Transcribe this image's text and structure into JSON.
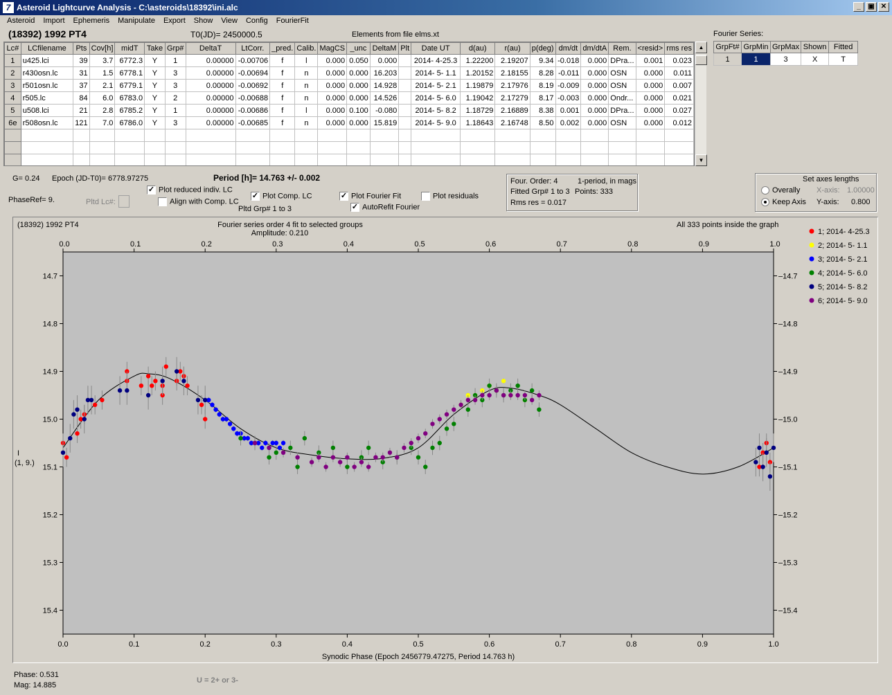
{
  "window": {
    "title": "Asteroid Lightcurve Analysis - C:\\asteroids\\18392\\ini.alc",
    "min": "_",
    "max": "▣",
    "close": "✕"
  },
  "menu": [
    "Asteroid",
    "Import",
    "Ephemeris",
    "Manipulate",
    "Export",
    "Show",
    "View",
    "Config",
    "FourierFit"
  ],
  "asteroid_name": "(18392) 1992 PT4",
  "t0": "T0(JD)= 2450000.5",
  "elements": "Elements from file elms.xt",
  "table": {
    "headers": [
      "Lc#",
      "LCfilename",
      "Pts",
      "Cov[h]",
      "midT",
      "Take",
      "Grp#",
      "DeltaT",
      "LtCorr.",
      "_pred.",
      "Calib.",
      "MagCS",
      "_unc",
      "DeltaM",
      "Plt",
      "Date UT",
      "d(au)",
      "r(au)",
      "p(deg)",
      "dm/dt",
      "dm/dtA",
      "Rem.",
      "<resid>",
      "rms res"
    ],
    "rows": [
      [
        "1",
        "u425.lci",
        "39",
        "3.7",
        "6772.3",
        "Y",
        "1",
        "0.00000",
        "-0.00706",
        "f",
        "l",
        "0.000",
        "0.050",
        "0.000",
        "",
        "2014- 4-25.3",
        "1.22200",
        "2.19207",
        "9.34",
        "-0.018",
        "0.000",
        "DPra...",
        "0.001",
        "0.023"
      ],
      [
        "2",
        "r430osn.lc",
        "31",
        "1.5",
        "6778.1",
        "Y",
        "3",
        "0.00000",
        "-0.00694",
        "f",
        "n",
        "0.000",
        "0.000",
        "16.203",
        "",
        "2014- 5- 1.1",
        "1.20152",
        "2.18155",
        "8.28",
        "-0.011",
        "0.000",
        "OSN",
        "0.000",
        "0.011"
      ],
      [
        "3",
        "r501osn.lc",
        "37",
        "2.1",
        "6779.1",
        "Y",
        "3",
        "0.00000",
        "-0.00692",
        "f",
        "n",
        "0.000",
        "0.000",
        "14.928",
        "",
        "2014- 5- 2.1",
        "1.19879",
        "2.17976",
        "8.19",
        "-0.009",
        "0.000",
        "OSN",
        "0.000",
        "0.007"
      ],
      [
        "4",
        "r505.lc",
        "84",
        "6.0",
        "6783.0",
        "Y",
        "2",
        "0.00000",
        "-0.00688",
        "f",
        "n",
        "0.000",
        "0.000",
        "14.526",
        "",
        "2014- 5- 6.0",
        "1.19042",
        "2.17279",
        "8.17",
        "-0.003",
        "0.000",
        "Ondr...",
        "0.000",
        "0.021"
      ],
      [
        "5",
        "u508.lci",
        "21",
        "2.8",
        "6785.2",
        "Y",
        "1",
        "0.00000",
        "-0.00686",
        "f",
        "l",
        "0.000",
        "0.100",
        "-0.080",
        "",
        "2014- 5- 8.2",
        "1.18729",
        "2.16889",
        "8.38",
        "0.001",
        "0.000",
        "DPra...",
        "0.000",
        "0.027"
      ],
      [
        "6e",
        "r508osn.lc",
        "121",
        "7.0",
        "6786.0",
        "Y",
        "3",
        "0.00000",
        "-0.00685",
        "f",
        "n",
        "0.000",
        "0.000",
        "15.819",
        "",
        "2014- 5- 9.0",
        "1.18643",
        "2.16748",
        "8.50",
        "0.002",
        "0.000",
        "OSN",
        "0.000",
        "0.012"
      ]
    ]
  },
  "fourier_series": {
    "label": "Fourier Series:",
    "headers": [
      "GrpFt#",
      "GrpMin",
      "GrpMax",
      "Shown",
      "Fitted"
    ],
    "row": [
      "1",
      "1",
      "3",
      "X",
      "T"
    ]
  },
  "controls": {
    "g": "G= 0.24",
    "epoch": "Epoch (JD-T0)= 6778.97275",
    "period": "Period [h]= 14.763 +/- 0.002",
    "phaseref": "PhaseRef= 9.",
    "pltd_lc": "Pltd Lc#:",
    "plot_reduced": "Plot reduced indiv. LC",
    "align_comp": "Align with Comp. LC",
    "plot_comp": "Plot Comp. LC",
    "pltd_grp": "Pltd Grp#  1   to    3",
    "plot_fourier": "Plot Fourier Fit",
    "autorefit": "AutoRefit Fourier",
    "plot_resid": "Plot residuals",
    "checked_mark": "✓"
  },
  "fourier_info": {
    "order": "Four. Order:  4",
    "period_mags": "1-period, in mags",
    "fitted": "Fitted Grp# 1 to 3",
    "points": "Points: 333",
    "rms": "Rms res     = 0.017"
  },
  "axes_lengths": {
    "title": "Set axes lengths",
    "overally": "Overally",
    "keep": "Keep Axis",
    "xaxis_label": "X-axis:",
    "xaxis_value": "1.00000",
    "yaxis_label": "Y-axis:",
    "yaxis_value": "0.800"
  },
  "status": {
    "phase": "Phase:  0.531",
    "mag": "Mag:   14.885",
    "u": "U = 2+ or 3-"
  },
  "chart_data": {
    "type": "scatter",
    "title": "(18392) 1992 PT4",
    "subtitle": "Fourier series order 4 fit to selected groups",
    "amplitude": "Amplitude: 0.210",
    "points_note": "All 333 points inside the graph",
    "xlabel": "Synodic Phase (Epoch 2456779.47275, Period 14.763 h)",
    "ylabel": "I",
    "ylabel2": "(1, 9.)",
    "xlim": [
      0.0,
      1.0
    ],
    "ylim": [
      15.45,
      14.65
    ],
    "y_inverted": true,
    "xticks": [
      "0.0",
      "0.1",
      "0.2",
      "0.3",
      "0.4",
      "0.5",
      "0.6",
      "0.7",
      "0.8",
      "0.9",
      "1.0"
    ],
    "yticks": [
      "14.7",
      "14.8",
      "14.9",
      "15.0",
      "15.1",
      "15.2",
      "15.3",
      "15.4"
    ],
    "fit_curve": {
      "x": [
        0.0,
        0.05,
        0.1,
        0.12,
        0.15,
        0.2,
        0.25,
        0.3,
        0.35,
        0.4,
        0.45,
        0.5,
        0.55,
        0.6,
        0.63,
        0.67,
        0.7,
        0.75,
        0.8,
        0.85,
        0.9,
        0.95,
        1.0
      ],
      "y": [
        15.06,
        14.96,
        14.91,
        14.905,
        14.915,
        14.96,
        15.02,
        15.06,
        15.075,
        15.083,
        15.082,
        15.06,
        14.99,
        14.94,
        14.935,
        14.95,
        14.97,
        15.02,
        15.07,
        15.1,
        15.115,
        15.1,
        15.06
      ]
    },
    "series": [
      {
        "name": "1; 2014- 4-25.3",
        "color": "#ff0000",
        "x": [
          0.0,
          0.005,
          0.02,
          0.025,
          0.03,
          0.045,
          0.055,
          0.09,
          0.09,
          0.11,
          0.12,
          0.125,
          0.13,
          0.14,
          0.14,
          0.145,
          0.16,
          0.165,
          0.17,
          0.175,
          0.195,
          0.2,
          0.98,
          0.985,
          0.99,
          0.995
        ],
        "y": [
          15.05,
          15.08,
          15.03,
          15.0,
          14.99,
          14.97,
          14.96,
          14.9,
          14.92,
          14.93,
          14.91,
          14.93,
          14.92,
          14.95,
          14.93,
          14.89,
          14.92,
          14.9,
          14.91,
          14.93,
          14.97,
          15.0,
          15.1,
          15.07,
          15.05,
          15.09
        ]
      },
      {
        "name": "2; 2014- 5- 1.1",
        "color": "#ffff00",
        "x": [
          0.56,
          0.57,
          0.58,
          0.59,
          0.6,
          0.61,
          0.62,
          0.63,
          0.65
        ],
        "y": [
          14.97,
          14.95,
          14.95,
          14.94,
          14.93,
          14.94,
          14.92,
          14.95,
          14.96
        ]
      },
      {
        "name": "3; 2014- 5- 2.1",
        "color": "#0000ff",
        "x": [
          0.2,
          0.205,
          0.21,
          0.215,
          0.22,
          0.225,
          0.23,
          0.235,
          0.24,
          0.245,
          0.25,
          0.255,
          0.26,
          0.265,
          0.27,
          0.275,
          0.28,
          0.285,
          0.29,
          0.295,
          0.3,
          0.305,
          0.31
        ],
        "y": [
          14.96,
          14.96,
          14.97,
          14.98,
          14.99,
          15.0,
          15.0,
          15.01,
          15.02,
          15.03,
          15.03,
          15.04,
          15.04,
          15.05,
          15.05,
          15.05,
          15.06,
          15.05,
          15.06,
          15.05,
          15.05,
          15.06,
          15.05
        ]
      },
      {
        "name": "4; 2014- 5- 6.0",
        "color": "#008000",
        "x": [
          0.25,
          0.27,
          0.29,
          0.3,
          0.32,
          0.33,
          0.34,
          0.36,
          0.38,
          0.4,
          0.42,
          0.43,
          0.45,
          0.47,
          0.49,
          0.5,
          0.51,
          0.52,
          0.53,
          0.54,
          0.55,
          0.57,
          0.58,
          0.59,
          0.6,
          0.61,
          0.62,
          0.63,
          0.64,
          0.65,
          0.66,
          0.67
        ],
        "y": [
          15.04,
          15.05,
          15.08,
          15.07,
          15.06,
          15.1,
          15.04,
          15.07,
          15.06,
          15.1,
          15.08,
          15.06,
          15.09,
          15.08,
          15.06,
          15.08,
          15.1,
          15.06,
          15.05,
          15.02,
          15.01,
          14.98,
          14.95,
          14.96,
          14.93,
          14.94,
          14.95,
          14.94,
          14.93,
          14.96,
          14.94,
          14.98
        ]
      },
      {
        "name": "5; 2014- 5- 8.2",
        "color": "#000080",
        "x": [
          0.0,
          0.01,
          0.015,
          0.02,
          0.03,
          0.035,
          0.04,
          0.08,
          0.09,
          0.12,
          0.14,
          0.16,
          0.17,
          0.19,
          0.2,
          0.975,
          0.98,
          0.985,
          0.99,
          0.995,
          1.0
        ],
        "y": [
          15.07,
          15.04,
          14.99,
          14.98,
          15.0,
          14.96,
          14.96,
          14.94,
          14.94,
          14.95,
          14.92,
          14.9,
          14.92,
          14.96,
          14.96,
          15.09,
          15.06,
          15.1,
          15.07,
          15.12,
          15.06
        ]
      },
      {
        "name": "6; 2014- 5- 9.0",
        "color": "#800080",
        "x": [
          0.27,
          0.29,
          0.31,
          0.33,
          0.35,
          0.36,
          0.37,
          0.38,
          0.39,
          0.4,
          0.41,
          0.42,
          0.43,
          0.44,
          0.45,
          0.46,
          0.47,
          0.48,
          0.49,
          0.5,
          0.51,
          0.52,
          0.53,
          0.54,
          0.55,
          0.56,
          0.57,
          0.58,
          0.59,
          0.6,
          0.61,
          0.62,
          0.63,
          0.64,
          0.65,
          0.66,
          0.67
        ],
        "y": [
          15.05,
          15.06,
          15.07,
          15.08,
          15.09,
          15.08,
          15.1,
          15.08,
          15.09,
          15.08,
          15.1,
          15.09,
          15.1,
          15.08,
          15.08,
          15.07,
          15.08,
          15.06,
          15.05,
          15.04,
          15.03,
          15.01,
          15.0,
          14.99,
          14.98,
          14.97,
          14.96,
          14.96,
          14.95,
          14.95,
          14.94,
          14.95,
          14.95,
          14.95,
          14.95,
          14.96,
          14.95
        ]
      }
    ]
  }
}
